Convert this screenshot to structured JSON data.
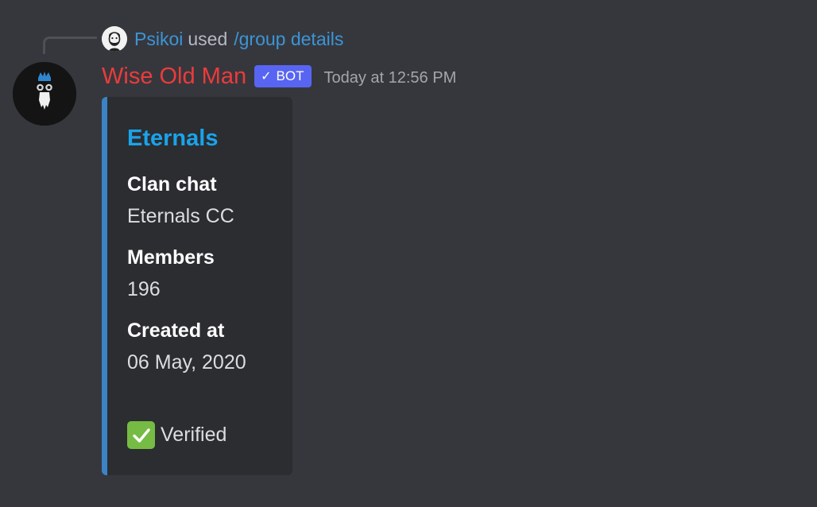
{
  "reply": {
    "user": "Psikoi",
    "used_text": "used",
    "command": "/group details"
  },
  "author": {
    "name": "Wise Old Man",
    "name_color": "#ec3b3b",
    "bot_tag": "BOT",
    "timestamp": "Today at 12:56 PM"
  },
  "embed": {
    "accent_color": "#3b83c4",
    "title": "Eternals",
    "fields": [
      {
        "name": "Clan chat",
        "value": "Eternals CC"
      },
      {
        "name": "Members",
        "value": "196"
      },
      {
        "name": "Created at",
        "value": "06 May, 2020"
      }
    ],
    "footer_icon": "check-mark-button-icon",
    "footer_text": "Verified"
  },
  "colors": {
    "background": "#36373d",
    "embed_background": "#2b2d31",
    "link_blue": "#3b95d6",
    "bot_tag_bg": "#5865f2",
    "verified_green": "#76bb44"
  }
}
